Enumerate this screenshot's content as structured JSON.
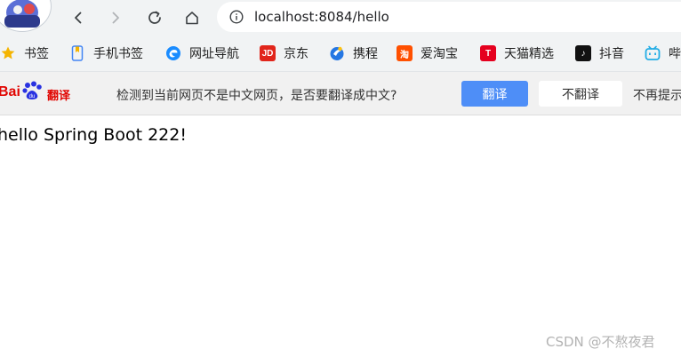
{
  "browser": {
    "url": "localhost:8084/hello",
    "icons": {
      "back": "back-arrow-icon",
      "forward": "forward-arrow-icon",
      "reload": "reload-icon",
      "home": "home-icon",
      "site_info": "info-icon"
    }
  },
  "bookmarks": [
    {
      "label": "书签",
      "icon": "star-icon",
      "color": "#f4b400"
    },
    {
      "label": "手机书签",
      "icon": "phone-bookmark-icon",
      "color": "#4285f4"
    },
    {
      "label": "网址导航",
      "icon": "edge-navigation-icon",
      "color": "#1a8cff"
    },
    {
      "label": "京东",
      "icon": "jd-logo-icon",
      "color": "#e1251b",
      "glyph": "JD"
    },
    {
      "label": "携程",
      "icon": "ctrip-logo-icon",
      "color": "#2577e3"
    },
    {
      "label": "爱淘宝",
      "icon": "taobao-logo-icon",
      "color": "#ff5000",
      "glyph": "淘"
    },
    {
      "label": "天猫精选",
      "icon": "tmall-logo-icon",
      "color": "#e5001e",
      "glyph": "T"
    },
    {
      "label": "抖音",
      "icon": "douyin-logo-icon",
      "color": "#111111",
      "glyph": "♪"
    },
    {
      "label": "哔",
      "icon": "bilibili-logo-icon",
      "color": "#23ade5"
    }
  ],
  "translate_bar": {
    "logo_text": "Bai",
    "logo_suffix": "翻译",
    "prompt": "检测到当前网页不是中文网页，是否要翻译成中文?",
    "translate_label": "翻译",
    "dont_translate_label": "不翻译",
    "never_label": "不再提示",
    "accent": "#4e8ef7"
  },
  "page": {
    "body_text": "hello Spring Boot 222!"
  },
  "watermark": "CSDN @不熬夜君"
}
